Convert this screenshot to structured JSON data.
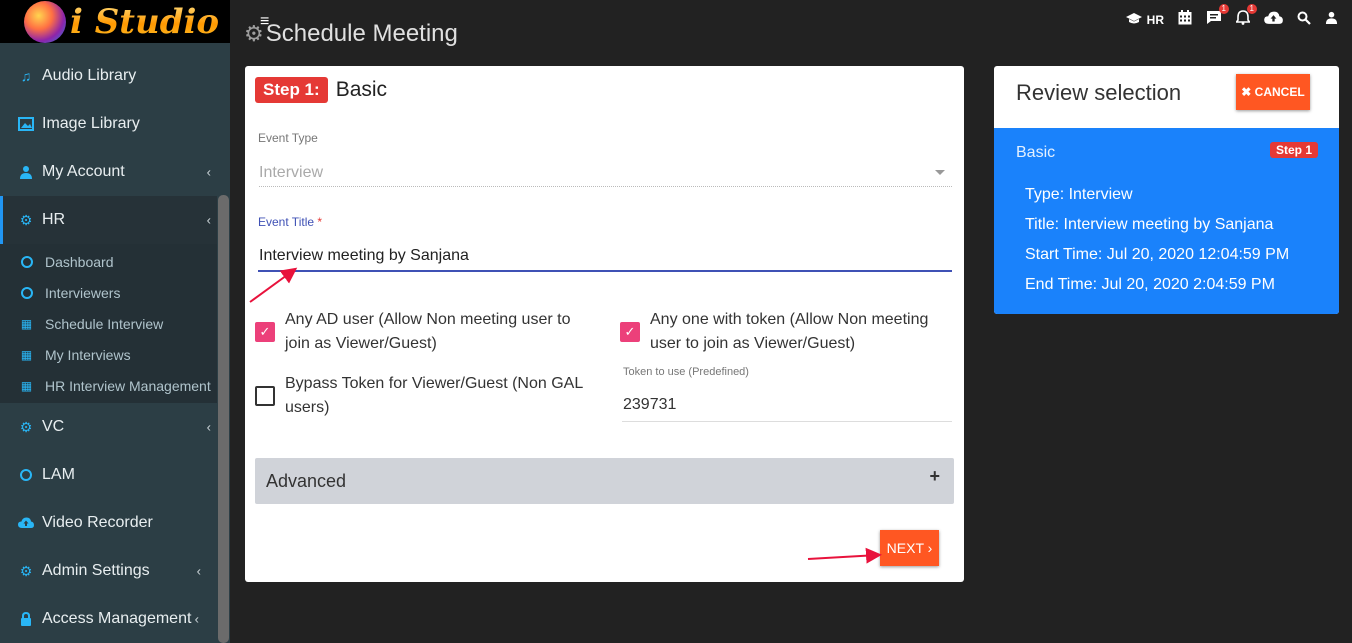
{
  "app": {
    "name": "i Studio"
  },
  "sidebar": {
    "items": [
      {
        "label": "Audio Library",
        "icon": "music-note-icon"
      },
      {
        "label": "Image Library",
        "icon": "image-icon"
      },
      {
        "label": "My Account",
        "icon": "user-icon"
      },
      {
        "label": "HR",
        "icon": "cogs-icon"
      },
      {
        "label": "VC",
        "icon": "cogs-icon"
      },
      {
        "label": "LAM",
        "icon": "circle-icon"
      },
      {
        "label": "Video Recorder",
        "icon": "cloud-upload-icon"
      },
      {
        "label": "Admin Settings",
        "icon": "cogs-icon"
      },
      {
        "label": "Access Management",
        "icon": "lock-icon"
      }
    ],
    "hr_submenu": [
      {
        "label": "Dashboard",
        "icon": "circle-icon"
      },
      {
        "label": "Interviewers",
        "icon": "circle-icon"
      },
      {
        "label": "Schedule Interview",
        "icon": "calendar-icon"
      },
      {
        "label": "My Interviews",
        "icon": "calendar-icon"
      },
      {
        "label": "HR Interview Management",
        "icon": "calendar-icon"
      }
    ]
  },
  "header": {
    "title": "Schedule Meeting",
    "role_label": "HR",
    "messages_badge": "1",
    "notifications_badge": "1"
  },
  "form": {
    "step_label": "Step 1:",
    "step_title": "Basic",
    "event_type_label": "Event Type",
    "event_type_value": "Interview",
    "event_title_label": "Event Title",
    "event_title_required": "*",
    "event_title_value": "Interview meeting by Sanjana",
    "any_ad_user_line1": "Any AD user (Allow Non meeting user to",
    "any_ad_user_line2": "join as Viewer/Guest)",
    "any_token_line1": "Any one with token (Allow Non meeting",
    "any_token_line2": "user to join as Viewer/Guest)",
    "bypass_line1": "Bypass Token for Viewer/Guest (Non GAL",
    "bypass_line2": "users)",
    "token_label": "Token to use (Predefined)",
    "token_value": "239731",
    "advanced_label": "Advanced",
    "next_label": "NEXT ›"
  },
  "review": {
    "title": "Review selection",
    "cancel_label": "✖ CANCEL",
    "section": "Basic",
    "step_badge": "Step 1",
    "type": "Type: Interview",
    "title_line": "Title: Interview meeting by Sanjana",
    "start": "Start Time: Jul 20, 2020 12:04:59 PM",
    "end": "End Time: Jul 20, 2020 2:04:59 PM"
  },
  "colors": {
    "accent_orange": "#ff5722",
    "step_red": "#e53935",
    "review_blue": "#1a82fb",
    "checkbox_pink": "#ec407a",
    "input_indigo": "#3f51b5"
  }
}
